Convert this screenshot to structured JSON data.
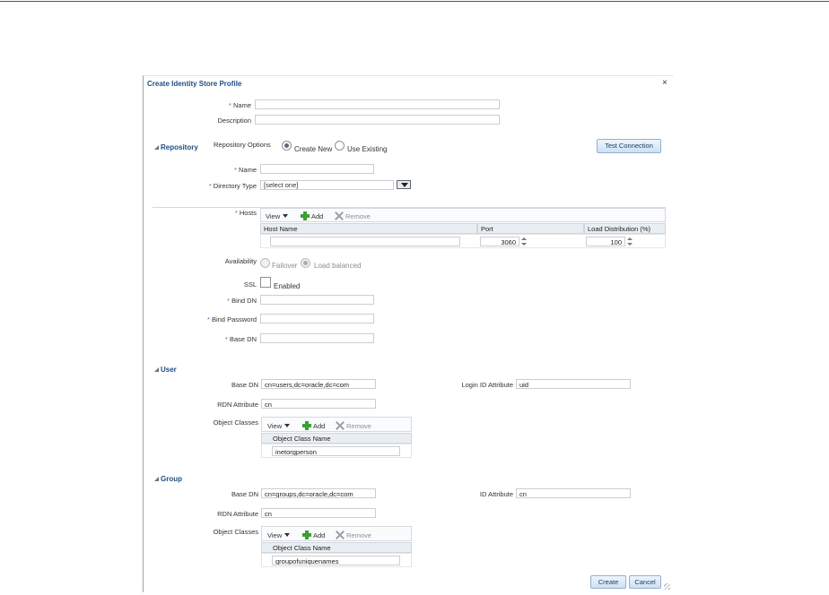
{
  "dialog": {
    "title": "Create Identity Store Profile",
    "close": "×",
    "name_label": "Name",
    "name_value": "",
    "description_label": "Description",
    "description_value": ""
  },
  "repository": {
    "section_label": "Repository",
    "options_label": "Repository Options",
    "option_create_new": "Create New",
    "option_use_existing": "Use Existing",
    "selected_option": "Create New",
    "test_connection_label": "Test Connection",
    "name_label": "Name",
    "name_value": "",
    "directory_type_label": "Directory Type",
    "directory_type_value": "[select one]",
    "hosts_label": "Hosts",
    "hosts_toolbar": {
      "view": "View",
      "add": "Add",
      "remove": "Remove"
    },
    "hosts_columns": [
      "Host Name",
      "Port",
      "Load Distribution (%)"
    ],
    "hosts_rows": [
      {
        "host": "",
        "port": "3060",
        "load": "100"
      }
    ],
    "availability_label": "Availability",
    "availability_failover": "Failover",
    "availability_load_balanced": "Load balanced",
    "ssl_label": "SSL",
    "ssl_enabled_label": "Enabled",
    "ssl_enabled": false,
    "bind_dn_label": "Bind DN",
    "bind_dn_value": "",
    "bind_password_label": "Bind Password",
    "bind_password_value": "",
    "base_dn_label": "Base DN",
    "base_dn_value": ""
  },
  "user": {
    "section_label": "User",
    "base_dn_label": "Base DN",
    "base_dn_value": "cn=users,dc=oracle,dc=com",
    "login_id_label": "Login ID Attribute",
    "login_id_value": "uid",
    "rdn_label": "RDN Attribute",
    "rdn_value": "cn",
    "object_classes_label": "Object Classes",
    "toolbar": {
      "view": "View",
      "add": "Add",
      "remove": "Remove"
    },
    "column": "Object Class Name",
    "rows": [
      "inetorgperson"
    ]
  },
  "group": {
    "section_label": "Group",
    "base_dn_label": "Base DN",
    "base_dn_value": "cn=groups,dc=oracle,dc=com",
    "id_label": "ID Attribute",
    "id_value": "cn",
    "rdn_label": "RDN Attribute",
    "rdn_value": "cn",
    "object_classes_label": "Object Classes",
    "toolbar": {
      "view": "View",
      "add": "Add",
      "remove": "Remove"
    },
    "column": "Object Class Name",
    "rows": [
      "groupofuniquenames"
    ]
  },
  "footer": {
    "create_label": "Create",
    "cancel_label": "Cancel"
  },
  "required_marker": "*"
}
